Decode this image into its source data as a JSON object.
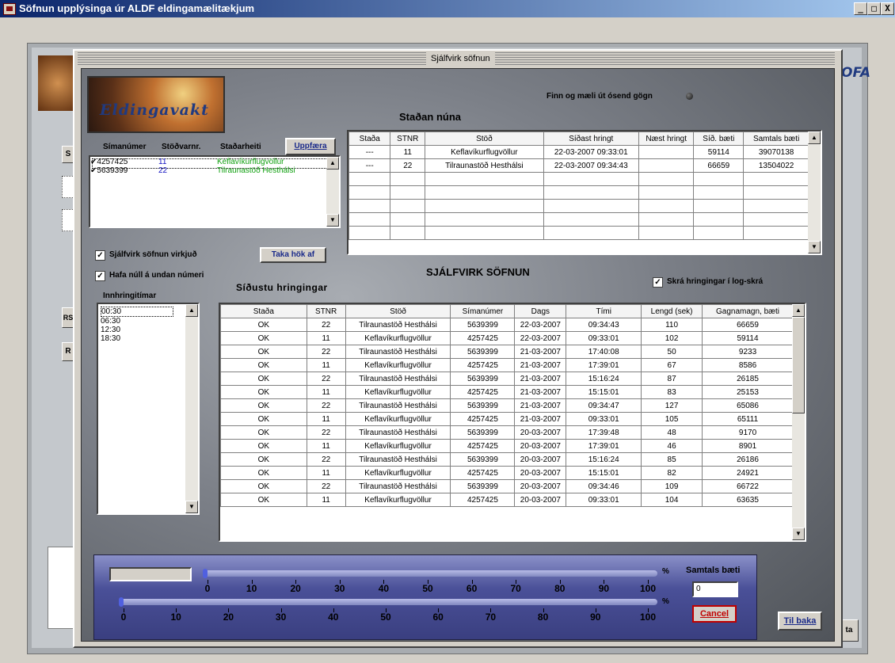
{
  "window": {
    "title": "Söfnun upplýsinga úr ALDF eldingamælitækjum",
    "min": "_",
    "max": "□",
    "close": "X"
  },
  "background": {
    "logo_text": "OFA",
    "btn_s": "S",
    "btn_rs": "RS",
    "btn_r": "R",
    "btn_ta": "ta"
  },
  "dialog": {
    "title": "Sjálfvirk söfnun"
  },
  "logo_text": "Eldingavakt",
  "finn_label": "Finn og mæli út ósend gögn",
  "stadan_nuna": "Staðan núna",
  "station_list": {
    "headers": [
      "Símanúmer",
      "Stöðvarnr.",
      "Staðarheiti"
    ],
    "update_button": "Uppfæra",
    "rows": [
      {
        "check": "✔",
        "phone": "4257425",
        "nr": "11",
        "name": "Keflavíkurflugvöllur"
      },
      {
        "check": "✔",
        "phone": "5639399",
        "nr": "22",
        "name": "Tilraunastöð Hesthálsi"
      }
    ]
  },
  "status_table": {
    "headers": [
      "Staða",
      "STNR",
      "Stöð",
      "Síðast hringt",
      "Næst hringt",
      "Síð. bæti",
      "Samtals bæti"
    ],
    "rows": [
      [
        "---",
        "11",
        "Keflavíkurflugvöllur",
        "22-03-2007 09:33:01",
        "",
        "59114",
        "39070138"
      ],
      [
        "---",
        "22",
        "Tilraunastöð Hesthálsi",
        "22-03-2007 09:34:43",
        "",
        "66659",
        "13504022"
      ]
    ],
    "empty_rows": 5
  },
  "checkboxes": {
    "auto_collect": {
      "label": "Sjálfvirk söfnun virkjuð",
      "checked": true
    },
    "zero_prefix": {
      "label": "Hafa núll á undan númeri",
      "checked": true
    },
    "log_file": {
      "label": "Skrá hringingar í log-skrá",
      "checked": true
    }
  },
  "take_button": "Taka hök af",
  "auto_heading": "SJÁLFVIRK SÖFNUN",
  "recent_calls_label": "Síðustu hringingar",
  "call_times": {
    "label": "Innhringitímar",
    "items": [
      "00:30",
      "06:30",
      "12:30",
      "18:30"
    ]
  },
  "calls_table": {
    "headers": [
      "Staða",
      "STNR",
      "Stöð",
      "Símanúmer",
      "Dags",
      "Tími",
      "Lengd (sek)",
      "Gagnamagn, bæti"
    ],
    "rows": [
      [
        "OK",
        "22",
        "Tilraunastöð Hesthálsi",
        "5639399",
        "22-03-2007",
        "09:34:43",
        "110",
        "66659"
      ],
      [
        "OK",
        "11",
        "Keflavíkurflugvöllur",
        "4257425",
        "22-03-2007",
        "09:33:01",
        "102",
        "59114"
      ],
      [
        "OK",
        "22",
        "Tilraunastöð Hesthálsi",
        "5639399",
        "21-03-2007",
        "17:40:08",
        "50",
        "9233"
      ],
      [
        "OK",
        "11",
        "Keflavíkurflugvöllur",
        "4257425",
        "21-03-2007",
        "17:39:01",
        "67",
        "8586"
      ],
      [
        "OK",
        "22",
        "Tilraunastöð Hesthálsi",
        "5639399",
        "21-03-2007",
        "15:16:24",
        "87",
        "26185"
      ],
      [
        "OK",
        "11",
        "Keflavíkurflugvöllur",
        "4257425",
        "21-03-2007",
        "15:15:01",
        "83",
        "25153"
      ],
      [
        "OK",
        "22",
        "Tilraunastöð Hesthálsi",
        "5639399",
        "21-03-2007",
        "09:34:47",
        "127",
        "65086"
      ],
      [
        "OK",
        "11",
        "Keflavíkurflugvöllur",
        "4257425",
        "21-03-2007",
        "09:33:01",
        "105",
        "65111"
      ],
      [
        "OK",
        "22",
        "Tilraunastöð Hesthálsi",
        "5639399",
        "20-03-2007",
        "17:39:48",
        "48",
        "9170"
      ],
      [
        "OK",
        "11",
        "Keflavíkurflugvöllur",
        "4257425",
        "20-03-2007",
        "17:39:01",
        "46",
        "8901"
      ],
      [
        "OK",
        "22",
        "Tilraunastöð Hesthálsi",
        "5639399",
        "20-03-2007",
        "15:16:24",
        "85",
        "26186"
      ],
      [
        "OK",
        "11",
        "Keflavíkurflugvöllur",
        "4257425",
        "20-03-2007",
        "15:15:01",
        "82",
        "24921"
      ],
      [
        "OK",
        "22",
        "Tilraunastöð Hesthálsi",
        "5639399",
        "20-03-2007",
        "09:34:46",
        "109",
        "66722"
      ],
      [
        "OK",
        "11",
        "Keflavíkurflugvöllur",
        "4257425",
        "20-03-2007",
        "09:33:01",
        "104",
        "63635"
      ]
    ]
  },
  "progress": {
    "scale": [
      "0",
      "10",
      "20",
      "30",
      "40",
      "50",
      "60",
      "70",
      "80",
      "90",
      "100"
    ],
    "percent_sign": "%",
    "bar1_value": 0,
    "bar2_value": 0
  },
  "total_bytes": {
    "label": "Samtals bæti",
    "value": "0"
  },
  "cancel_button": "Cancel",
  "back_button": "Til baka"
}
